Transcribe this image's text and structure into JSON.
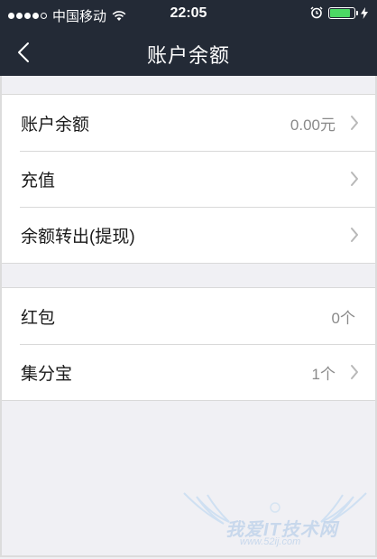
{
  "status_bar": {
    "carrier": "中国移动",
    "time": "22:05",
    "battery_level": 0.85,
    "signal_bars_filled": 4,
    "signal_bars_total": 5
  },
  "nav": {
    "title": "账户余额",
    "back_icon": "chevron-left-icon"
  },
  "groups": [
    {
      "rows": [
        {
          "label": "账户余额",
          "value": "0.00元",
          "chevron": true
        },
        {
          "label": "充值",
          "value": "",
          "chevron": true
        },
        {
          "label": "余额转出(提现)",
          "value": "",
          "chevron": true
        }
      ]
    },
    {
      "rows": [
        {
          "label": "红包",
          "value": "0个",
          "chevron": false
        },
        {
          "label": "集分宝",
          "value": "1个",
          "chevron": true
        }
      ]
    }
  ],
  "watermark": {
    "text": "我爱IT技术网",
    "url": "www.52ij.com"
  },
  "colors": {
    "nav_background": "#232a36",
    "page_background": "#f0f0f4",
    "battery_green": "#4cd964"
  }
}
